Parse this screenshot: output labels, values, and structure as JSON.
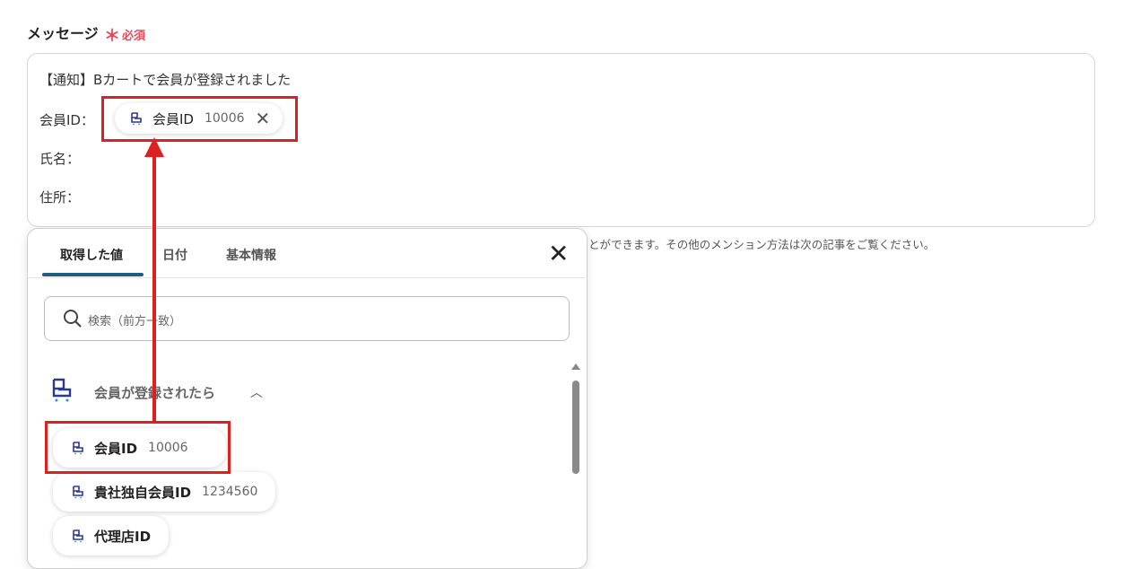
{
  "field": {
    "label": "メッセージ",
    "required_mark": "＊",
    "required_text": "必須"
  },
  "message": {
    "line1": "【通知】Bカートで会員が登録されました",
    "line2_label": "会員ID：",
    "line3_label": "氏名：",
    "line4_label": "住所：",
    "inserted_chip": {
      "label": "会員ID",
      "value": "10006",
      "icon": "bcart-icon",
      "remove_icon": "close-icon"
    }
  },
  "hint_text": "とができます。その他のメンション方法は次の記事をご覧ください。",
  "panel": {
    "tabs": [
      {
        "label": "取得した値",
        "active": true
      },
      {
        "label": "日付",
        "active": false
      },
      {
        "label": "基本情報",
        "active": false
      }
    ],
    "search_placeholder": "検索（前方一致）",
    "group": {
      "label": "会員が登録されたら",
      "icon": "bcart-icon",
      "expanded": true
    },
    "items": [
      {
        "label": "会員ID",
        "value": "10006"
      },
      {
        "label": "貴社独自会員ID",
        "value": "1234560"
      },
      {
        "label": "代理店ID",
        "value": ""
      }
    ]
  },
  "colors": {
    "accent_red": "#e02020",
    "required_red": "#e44b5a",
    "tab_underline": "#1f5f7a",
    "icon_blue": "#2b3a8f"
  }
}
